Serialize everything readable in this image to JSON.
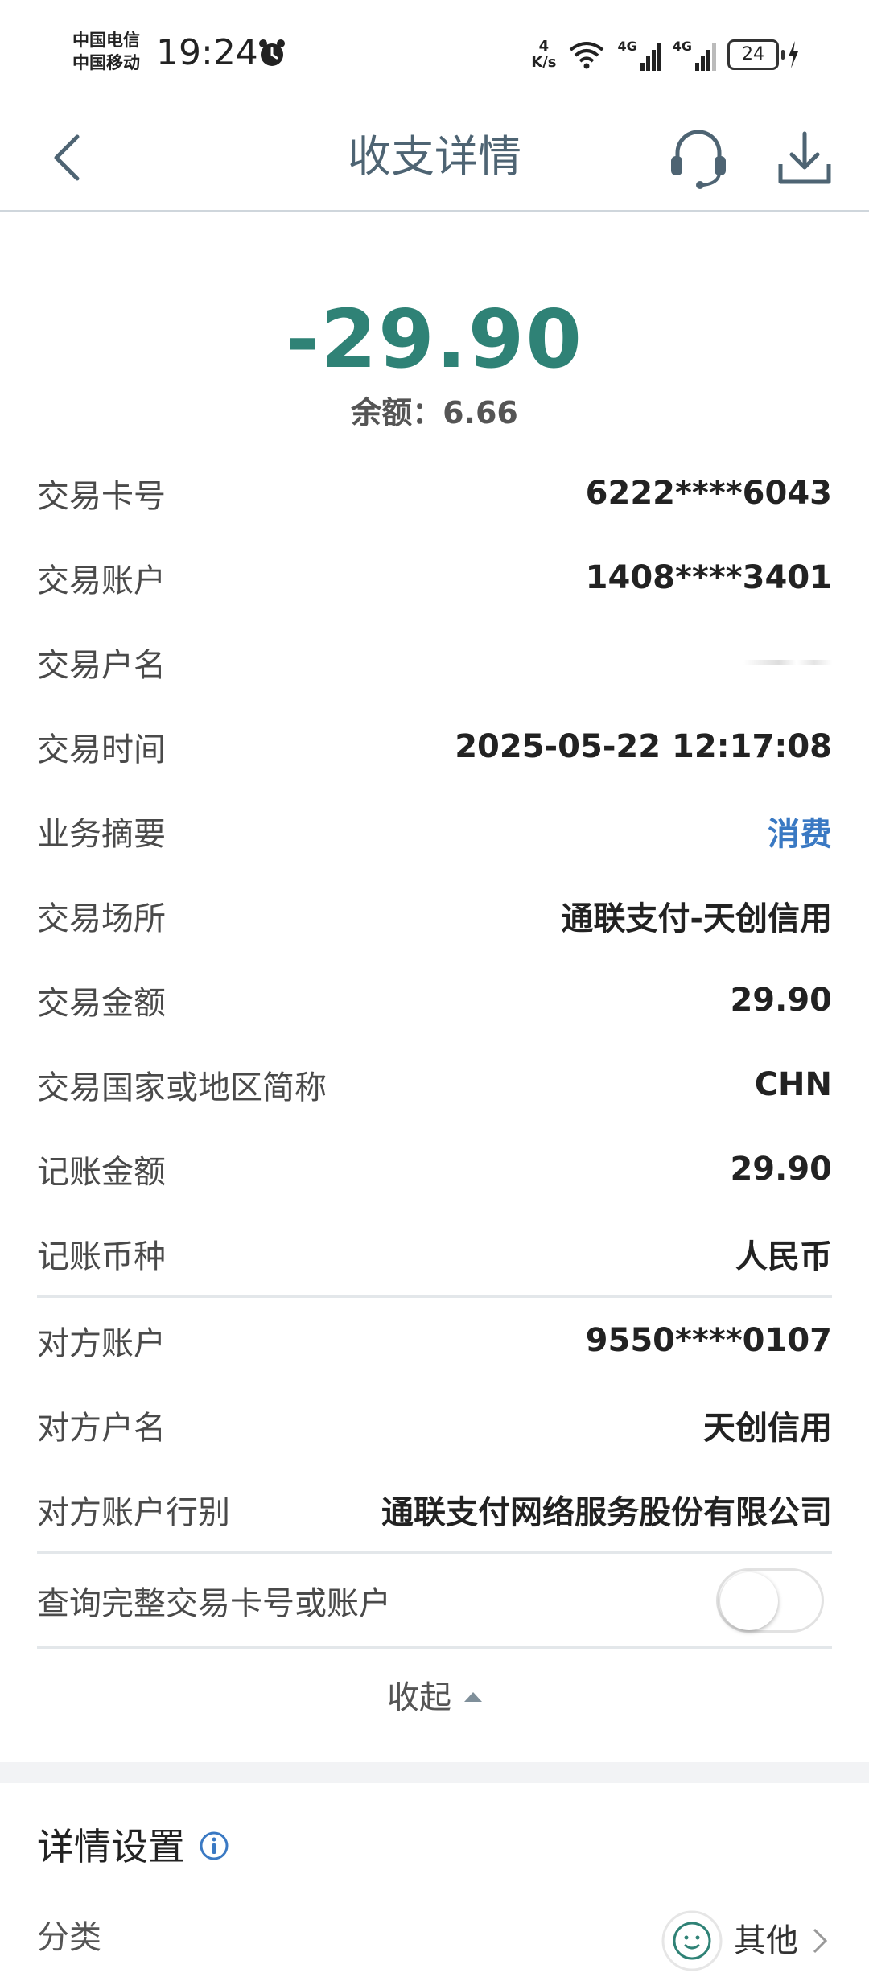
{
  "status_bar": {
    "carrier_1": "中国电信",
    "carrier_2": "中国移动",
    "time": "19:24",
    "net_speed_value": "4",
    "net_speed_unit": "K/s",
    "signal_tag_1": "4G",
    "signal_tag_2": "4G",
    "battery": "24"
  },
  "header": {
    "title": "收支详情",
    "back_icon": "chevron-left-icon",
    "service_icon": "headset-icon",
    "download_icon": "download-icon"
  },
  "summary": {
    "amount": "-29.90",
    "balance": "余额：6.66"
  },
  "details": {
    "card_no": {
      "label": "交易卡号",
      "value": "6222****6043"
    },
    "account": {
      "label": "交易账户",
      "value": "1408****3401"
    },
    "account_name": {
      "label": "交易户名",
      "value": ""
    },
    "time": {
      "label": "交易时间",
      "value": "2025-05-22 12:17:08"
    },
    "summary": {
      "label": "业务摘要",
      "value": "消费"
    },
    "place": {
      "label": "交易场所",
      "value": "通联支付-天创信用"
    },
    "amount": {
      "label": "交易金额",
      "value": "29.90"
    },
    "country": {
      "label": "交易国家或地区简称",
      "value": "CHN"
    },
    "posted_amount": {
      "label": "记账金额",
      "value": "29.90"
    },
    "currency": {
      "label": "记账币种",
      "value": "人民币"
    },
    "counterparty_account": {
      "label": "对方账户",
      "value": "9550****0107"
    },
    "counterparty_name": {
      "label": "对方户名",
      "value": "天创信用"
    },
    "counterparty_bank": {
      "label": "对方账户行别",
      "value": "通联支付网络服务股份有限公司"
    },
    "full_query": {
      "label": "查询完整交易卡号或账户",
      "toggle_on": false
    }
  },
  "collapse_label": "收起",
  "settings": {
    "title": "详情设置",
    "category_label": "分类",
    "category_value": "其他"
  },
  "colors": {
    "amount": "#2f8276",
    "link": "#3a79c3",
    "title": "#4e6473"
  }
}
